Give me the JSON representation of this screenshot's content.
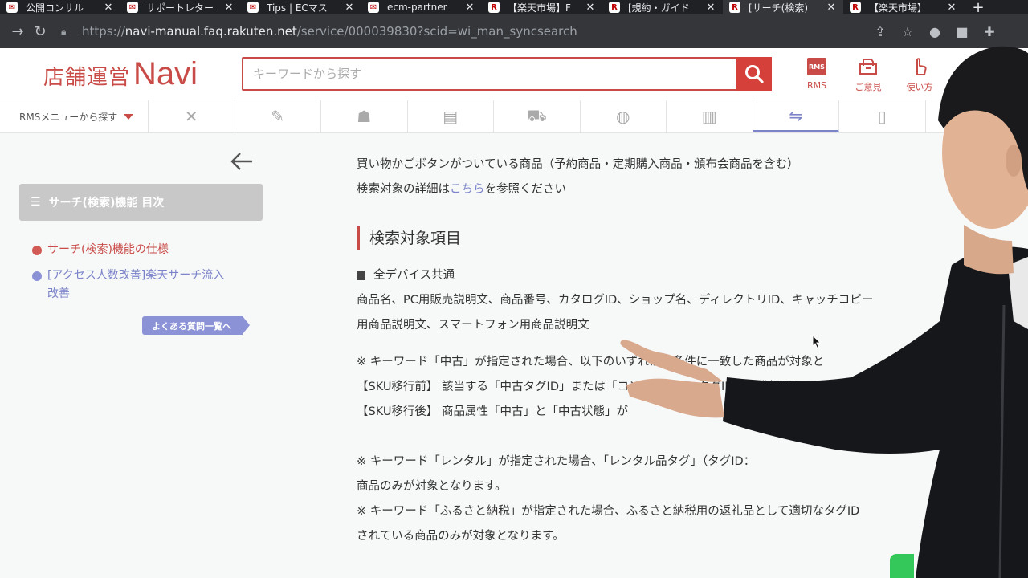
{
  "browser": {
    "tabs": [
      {
        "title": "公開コンサル"
      },
      {
        "title": "サポートレター"
      },
      {
        "title": "Tips | ECマス"
      },
      {
        "title": "ecm-partner"
      },
      {
        "title": "【楽天市場】F"
      },
      {
        "title": "[規約・ガイド"
      },
      {
        "title": "[サーチ(検索)"
      },
      {
        "title": "【楽天市場】"
      }
    ],
    "url_scheme": "https://",
    "url_host": "navi-manual.faq.rakuten.net",
    "url_path": "/service/000039830?scid=wi_man_syncsearch"
  },
  "header": {
    "logo_jp": "店舗運営",
    "logo_en": "Navi",
    "search_placeholder": "キーワードから探す",
    "links": [
      {
        "label": "RMS",
        "icon": "rms-icon"
      },
      {
        "label": "ご意見",
        "icon": "feedback-icon"
      },
      {
        "label": "使い方",
        "icon": "hand-pointer-icon"
      }
    ]
  },
  "menu": {
    "dropdown_label": "RMSメニューから探す"
  },
  "sidebar": {
    "toc_title": "サーチ(検索)機能 目次",
    "items": [
      {
        "label": "サーチ(検索)機能の仕様"
      },
      {
        "label": "[アクセス人数改善]楽天サーチ流入改善"
      }
    ],
    "faq_button": "よくある質問一覧へ"
  },
  "content": {
    "intro_line1": "買い物かごボタンがついている商品（予約商品・定期購入商品・頒布会商品を含む）",
    "intro_line2_a": "検索対象の詳細は",
    "intro_line2_link": "こちら",
    "intro_line2_b": "を参照ください",
    "section_title": "検索対象項目",
    "subheading": "全デバイス共通",
    "fields_line1": "商品名、PC用販売説明文、商品番号、カタログID、ショップ名、ディレクトリID、キャッチコピー",
    "fields_line2": "用商品説明文、スマートフォン用商品説明文",
    "note1_line1": "※ キーワード「中古」が指定された場合、以下のいずれかの条件に一致した商品が対象と",
    "note1_line2": "【SKU移行前】 該当する「中古タグID」または「コンディションタグID」が登録され",
    "note1_line3": "【SKU移行後】 商品属性「中古」と「中古状態」が",
    "note2_line1": "※ キーワード「レンタル」が指定された場合、「レンタル品タグ」（タグID：",
    "note2_line2": "商品のみが対象となります。",
    "note3_line1": "※ キーワード「ふるさと納税」が指定された場合、ふるさと納税用の返礼品として適切なタグID",
    "note3_line2": "されている商品のみが対象となります。"
  },
  "colors": {
    "brand": "#c94b47",
    "accent": "#7b83c9"
  }
}
